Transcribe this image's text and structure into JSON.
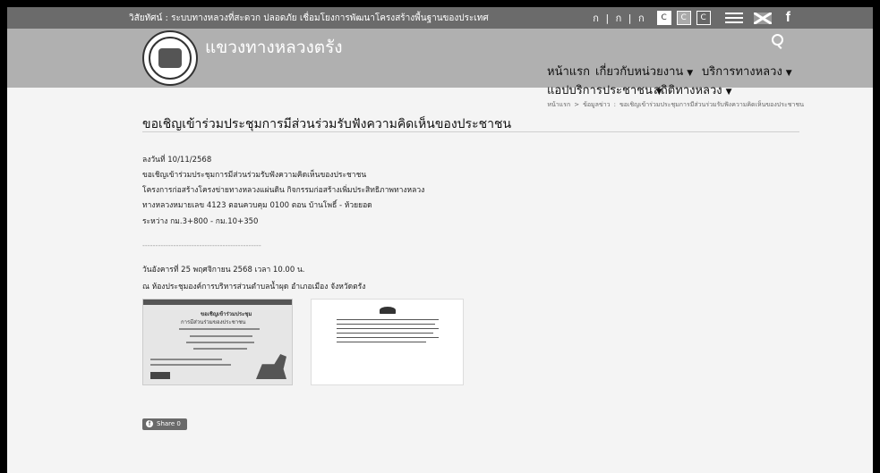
{
  "topbar": {
    "vision": "วิสัยทัศน์ : ระบบทางหลวงที่สะดวก ปลอดภัย เชื่อมโยงการพัฒนาโครงสร้างพื้นฐานของประเทศ",
    "font_size_controls": "ก | ก | ก",
    "contrast_buttons": [
      "C",
      "C",
      "C"
    ]
  },
  "header": {
    "site_name": "แขวงทางหลวงตรัง"
  },
  "nav": {
    "home": "หน้าแรก",
    "about": "เกี่ยวกับหน่วยงาน",
    "services": "บริการทางหลวง",
    "app_services": "แอปบริการประชาชน",
    "stats": "สถิติทางหลวง"
  },
  "breadcrumb": {
    "home": "หน้าแรก",
    "news": "ข้อมูลข่าว",
    "current": "ขอเชิญเข้าร่วมประชุมการมีส่วนร่วมรับฟังความคิดเห็นของประชาชน"
  },
  "article": {
    "title": "ขอเชิญเข้าร่วมประชุมการมีส่วนร่วมรับฟังความคิดเห็นของประชาชน",
    "lines": [
      "ลงวันที่ 10/11/2568",
      "ขอเชิญเข้าร่วมประชุมการมีส่วนร่วมรับฟังความคิดเห็นของประชาชน",
      "โครงการก่อสร้างโครงข่ายทางหลวงแผ่นดิน  กิจกรรมก่อสร้างเพิ่มประสิทธิภาพทางหลวง",
      "ทางหลวงหมายเลข 4123 ตอนควบคุม 0100 ตอน บ้านโพธิ์ - ห้วยยอด",
      "ระหว่าง กม.3+800 - กม.10+350"
    ],
    "divider": "----------------------------------------------",
    "meeting_lines": [
      "วันอังคารที่ 25  พฤศจิกายน  2568   เวลา 10.00 น.",
      "ณ ห้องประชุมองค์การบริหารส่วนตำบลน้ำผุด อำเภอเมือง จังหวัดตรัง"
    ]
  },
  "thumbnail1": {
    "title": "ขอเชิญเข้าร่วมประชุม",
    "subtitle": "การมีส่วนร่วมของประชาชน"
  },
  "share": {
    "label": "Share 0"
  }
}
